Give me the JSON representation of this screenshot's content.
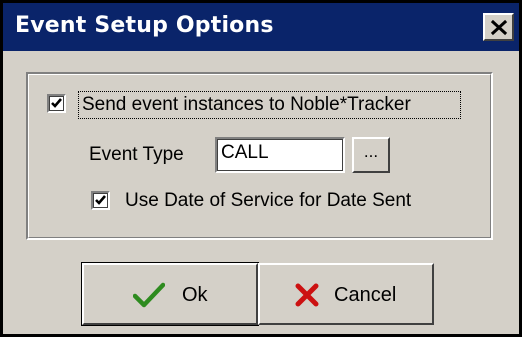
{
  "window": {
    "title": "Event Setup Options",
    "close_icon": "close-icon",
    "title_bar_color": "#0a246a",
    "background_color": "#d4d0c8"
  },
  "options": {
    "send_to_tracker": {
      "label": "Send event instances to Noble*Tracker",
      "checked": true
    },
    "event_type": {
      "label": "Event Type",
      "value": "CALL",
      "browse_label": "..."
    },
    "use_date_of_service": {
      "label": "Use Date of Service for Date Sent",
      "checked": true
    }
  },
  "buttons": {
    "ok": {
      "label": "Ok",
      "icon": "checkmark-icon",
      "icon_color": "#2e8b1f"
    },
    "cancel": {
      "label": "Cancel",
      "icon": "x-mark-icon",
      "icon_color": "#cc1111"
    }
  }
}
